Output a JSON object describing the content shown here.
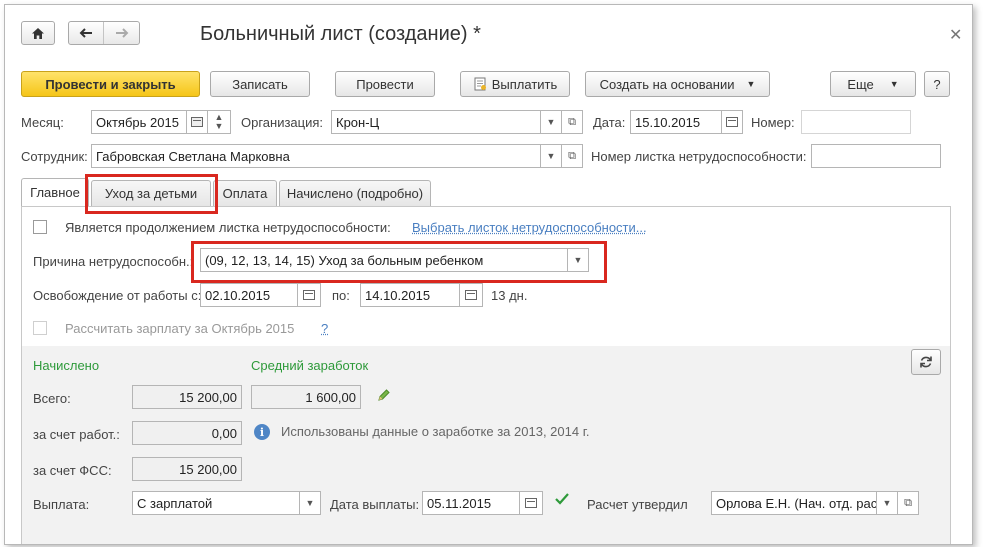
{
  "window": {
    "title": "Больничный лист (создание) *"
  },
  "toolbar": {
    "post_close": "Провести и закрыть",
    "save": "Записать",
    "post": "Провести",
    "pay": "Выплатить",
    "create_based": "Создать на основании",
    "more": "Еще",
    "help": "?"
  },
  "header": {
    "month_label": "Месяц:",
    "month_value": "Октябрь 2015",
    "org_label": "Организация:",
    "org_value": "Крон-Ц",
    "date_label": "Дата:",
    "date_value": "15.10.2015",
    "number_label": "Номер:",
    "number_value": "",
    "employee_label": "Сотрудник:",
    "employee_value": "Габровская Светлана Марковна",
    "sheet_number_label": "Номер листка нетрудоспособности:",
    "sheet_number_value": ""
  },
  "tabs": [
    {
      "label": "Главное"
    },
    {
      "label": "Уход за детьми"
    },
    {
      "label": "Оплата"
    },
    {
      "label": "Начислено (подробно)"
    }
  ],
  "main": {
    "continuation_label": "Является продолжением листка нетрудоспособности:",
    "continuation_link": "Выбрать листок нетрудоспособности...",
    "reason_label": "Причина нетрудоспособн.:",
    "reason_value": "(09, 12, 13, 14, 15) Уход за больным ребенком",
    "release_label": "Освобождение от работы с:",
    "release_from": "02.10.2015",
    "release_to_label": "по:",
    "release_to": "14.10.2015",
    "release_days": "13 дн.",
    "calc_salary_label": "Рассчитать зарплату за Октябрь 2015",
    "calc_salary_help": "?",
    "accrued_label": "Начислено",
    "avg_earnings_label": "Средний заработок",
    "total_label": "Всего:",
    "total_value": "15 200,00",
    "avg_value": "1 600,00",
    "employer_label": "за счет работ.:",
    "employer_value": "0,00",
    "fss_label": "за счет ФСС:",
    "fss_value": "15 200,00",
    "info_text": "Использованы данные о заработке за  2013,  2014 г.",
    "payout_label": "Выплата:",
    "payout_value": "С зарплатой",
    "payout_date_label": "Дата выплаты:",
    "payout_date_value": "05.11.2015",
    "approved_label": "Расчет утвердил",
    "approved_value": "Орлова Е.Н. (Нач. отд. рас"
  },
  "colors": {
    "primary_button": "#f5c518",
    "highlight_box": "#d9281f",
    "green_heading": "#2e9a3a",
    "link": "#4a7fc1"
  }
}
